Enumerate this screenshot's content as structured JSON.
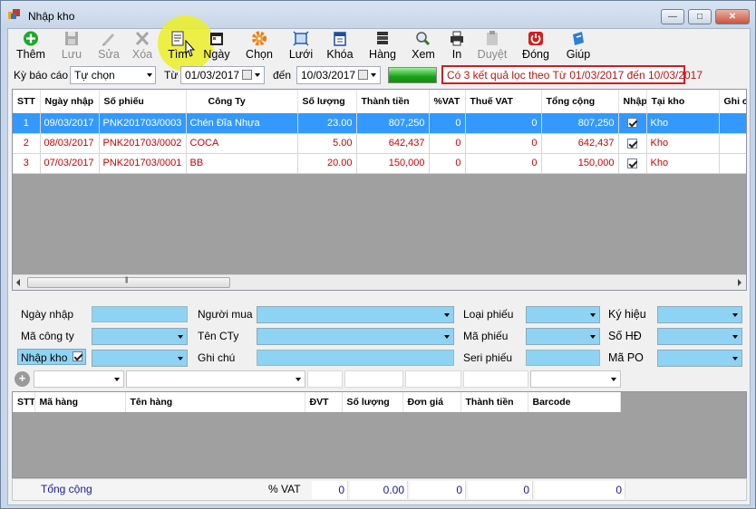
{
  "window": {
    "title": "Nhập kho",
    "min": "—",
    "max": "□",
    "close": "✕"
  },
  "toolbar": [
    {
      "label": "Thêm",
      "icon": "add-icon",
      "enabled": true
    },
    {
      "label": "Lưu",
      "icon": "save-icon",
      "enabled": false
    },
    {
      "label": "Sửa",
      "icon": "edit-icon",
      "enabled": false
    },
    {
      "label": "Xóa",
      "icon": "delete-icon",
      "enabled": false
    },
    {
      "label": "Tìm",
      "icon": "find-icon",
      "enabled": true
    },
    {
      "label": "Ngày",
      "icon": "calendar-icon",
      "enabled": true
    },
    {
      "label": "Chọn",
      "icon": "gear-icon",
      "enabled": true
    },
    {
      "label": "Lưới",
      "icon": "grid-icon",
      "enabled": true
    },
    {
      "label": "Khóa",
      "icon": "lock-icon",
      "enabled": true
    },
    {
      "label": "Hàng",
      "icon": "books-icon",
      "enabled": true
    },
    {
      "label": "Xem",
      "icon": "preview-icon",
      "enabled": true
    },
    {
      "label": "In",
      "icon": "printer-icon",
      "enabled": true
    },
    {
      "label": "Duyệt",
      "icon": "approve-icon",
      "enabled": false
    },
    {
      "label": "Đóng",
      "icon": "power-icon",
      "enabled": true
    },
    {
      "label": "Giúp",
      "icon": "help-icon",
      "enabled": true
    }
  ],
  "filter": {
    "ky_bao_cao_label": "Kỳ báo cáo",
    "ky_bao_cao_value": "Tự chọn",
    "tu_label": "Từ",
    "tu_value": "01/03/2017",
    "den_label": "đến",
    "den_value": "10/03/2017",
    "result_message": "Có 3 kết quả lọc theo Từ 01/03/2017 đến 10/03/2017"
  },
  "main_grid": {
    "columns": [
      "STT",
      "Ngày nhập",
      "Số phiếu",
      "Công Ty",
      "Số lượng",
      "Thành tiền",
      "%VAT",
      "Thuế VAT",
      "Tổng cộng",
      "Nhập",
      "Tại kho",
      "Ghi c"
    ],
    "rows": [
      {
        "stt": "1",
        "ngay": "09/03/2017",
        "so_phieu": "PNK201703/0003",
        "cong_ty": "Chén Đĩa Nhựa",
        "so_luong": "23.00",
        "thanh_tien": "807,250",
        "vat": "0",
        "thue": "0",
        "tong": "807,250",
        "nhap": true,
        "kho": "Kho",
        "selected": true
      },
      {
        "stt": "2",
        "ngay": "08/03/2017",
        "so_phieu": "PNK201703/0002",
        "cong_ty": "COCA",
        "so_luong": "5.00",
        "thanh_tien": "642,437",
        "vat": "0",
        "thue": "0",
        "tong": "642,437",
        "nhap": true,
        "kho": "Kho",
        "selected": false
      },
      {
        "stt": "3",
        "ngay": "07/03/2017",
        "so_phieu": "PNK201703/0001",
        "cong_ty": "BB",
        "so_luong": "20.00",
        "thanh_tien": "150,000",
        "vat": "0",
        "thue": "0",
        "tong": "150,000",
        "nhap": true,
        "kho": "Kho",
        "selected": false
      }
    ],
    "scroll_grip": "|||"
  },
  "form": {
    "ngay_nhap": "Ngày nhập",
    "ma_cong_ty": "Mã công ty",
    "nhap_kho": "Nhập kho",
    "nguoi_mua": "Người mua",
    "ten_cty": "Tên CTy",
    "ghi_chu": "Ghi chú",
    "loai_phieu": "Loại phiếu",
    "ma_phieu": "Mã phiếu",
    "seri_phieu": "Seri phiếu",
    "ky_hieu": "Ký hiệu",
    "so_hd": "Số HĐ",
    "ma_po": "Mã PO",
    "add_symbol": "+"
  },
  "detail_grid": {
    "columns": [
      "STT",
      "Mã hàng",
      "Tên hàng",
      "ĐVT",
      "Số lượng",
      "Đơn giá",
      "Thành tiền",
      "Barcode"
    ]
  },
  "footer": {
    "tong_cong": "Tổng cộng",
    "vat_label": "% VAT",
    "vat_value": "0",
    "so_luong": "0.00",
    "don_gia": "0",
    "thanh_tien": "0",
    "tong": "0"
  },
  "colors": {
    "accent_blue": "#3399ff",
    "input_blue": "#8fd3f4",
    "red_text": "#cc0000",
    "highlight_yellow": "#ecee28"
  }
}
